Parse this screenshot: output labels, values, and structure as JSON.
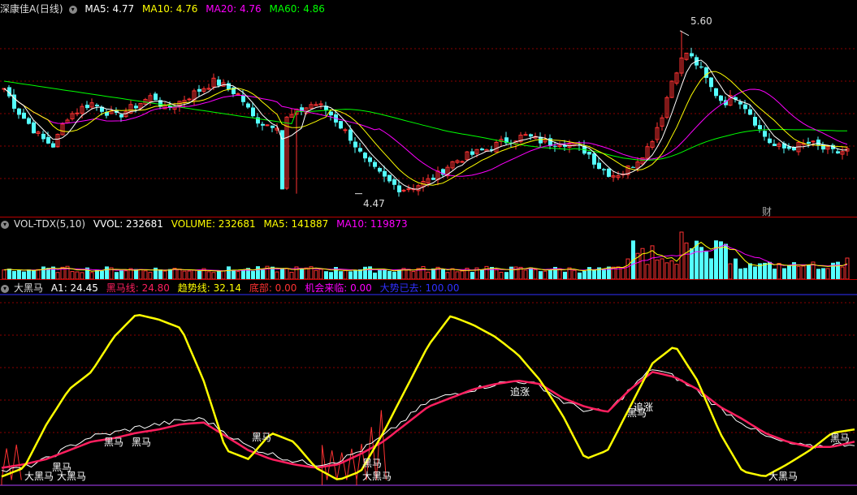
{
  "colors": {
    "up": "#ff3232",
    "down": "#54ffff",
    "ma5": "#ffffff",
    "ma10": "#ffff00",
    "ma20": "#ff00ff",
    "ma60": "#00ff00",
    "yellow": "#ffff00",
    "red": "#ff1f5f",
    "blue": "#3030ff",
    "white": "#ffffff",
    "grid": "#8b0000"
  },
  "main": {
    "title": "深康佳A(日线)",
    "ma5": "MA5: 4.77",
    "ma10": "MA10: 4.76",
    "ma20": "MA20: 4.76",
    "ma60": "MA60: 4.86",
    "high_label": "5.60",
    "low_label": "4.47",
    "cai_label": "财"
  },
  "vol": {
    "name": "VOL-TDX(5,10)",
    "vvol": "VVOL: 232681",
    "volume": "VOLUME: 232681",
    "ma5": "MA5: 141887",
    "ma10": "MA10: 119873"
  },
  "ind": {
    "name": "大黑马",
    "a1": "A1: 24.45",
    "hmx": "黑马线: 24.80",
    "qsx": "趋势线: 32.14",
    "db": "底部: 0.00",
    "jhll": "机会来临: 0.00",
    "dsyq": "大势已去: 100.00",
    "labels": [
      "黑马",
      "黑马",
      "黑马",
      "黑马",
      "大黑马",
      "大黑马",
      "黑马",
      "大黑马",
      "追涨",
      "追涨",
      "黑马",
      "大黑马",
      "黑马"
    ]
  },
  "chart_data": [
    {
      "type": "candlestick",
      "title": "深康佳A(日线)",
      "price_high": 5.6,
      "price_low": 4.47,
      "ylim": [
        4.35,
        5.7
      ],
      "close_trend": [
        5.2,
        5.05,
        4.95,
        4.85,
        4.8,
        5.0,
        5.05,
        5.1,
        5.05,
        5.0,
        5.05,
        5.1,
        5.15,
        5.05,
        5.1,
        5.15,
        5.2,
        5.25,
        5.2,
        5.15,
        5.0,
        4.95,
        4.95,
        5.0,
        5.05,
        5.1,
        5.05,
        4.95,
        4.85,
        4.7,
        4.62,
        4.55,
        4.5,
        4.52,
        4.55,
        4.6,
        4.68,
        4.72,
        4.75,
        4.78,
        4.82,
        4.85,
        4.87,
        4.84,
        4.82,
        4.83,
        4.8,
        4.76,
        4.65,
        4.6,
        4.62,
        4.7,
        4.8,
        5.0,
        5.3,
        5.45,
        5.35,
        5.2,
        5.1,
        5.15,
        5.05,
        4.9,
        4.8,
        4.78,
        4.8,
        4.82,
        4.78,
        4.75,
        4.77
      ]
    },
    {
      "type": "bar",
      "title": "VOL-TDX(5,10)",
      "series": [
        {
          "name": "VOLUME",
          "last": 232681
        },
        {
          "name": "MA5",
          "last": 141887
        },
        {
          "name": "MA10",
          "last": 119873
        }
      ]
    },
    {
      "type": "line",
      "title": "大黑马",
      "ylim": [
        0,
        100
      ],
      "series": [
        {
          "name": "趋势线",
          "values": [
            5,
            10,
            35,
            55,
            65,
            85,
            98,
            95,
            90,
            60,
            20,
            15,
            30,
            25,
            10,
            3,
            8,
            30,
            55,
            80,
            97,
            92,
            85,
            75,
            60,
            40,
            15,
            20,
            45,
            70,
            80,
            60,
            30,
            8,
            5,
            12,
            20,
            30,
            32
          ]
        },
        {
          "name": "黑马线",
          "values": [
            10,
            12,
            15,
            20,
            25,
            27,
            30,
            32,
            35,
            36,
            28,
            20,
            15,
            12,
            10,
            12,
            18,
            25,
            35,
            45,
            50,
            55,
            58,
            60,
            58,
            50,
            45,
            42,
            55,
            65,
            62,
            55,
            45,
            38,
            30,
            25,
            22,
            22,
            25
          ]
        },
        {
          "name": "A1",
          "values": [
            8,
            10,
            15,
            22,
            28,
            30,
            33,
            35,
            37,
            38,
            30,
            22,
            18,
            14,
            12,
            14,
            20,
            28,
            38,
            48,
            52,
            55,
            58,
            60,
            57,
            48,
            43,
            42,
            55,
            67,
            62,
            54,
            44,
            36,
            28,
            24,
            22,
            23,
            24
          ]
        }
      ],
      "last": {
        "A1": 24.45,
        "黑马线": 24.8,
        "趋势线": 32.14,
        "底部": 0.0,
        "机会来临": 0.0,
        "大势已去": 100.0
      }
    }
  ]
}
